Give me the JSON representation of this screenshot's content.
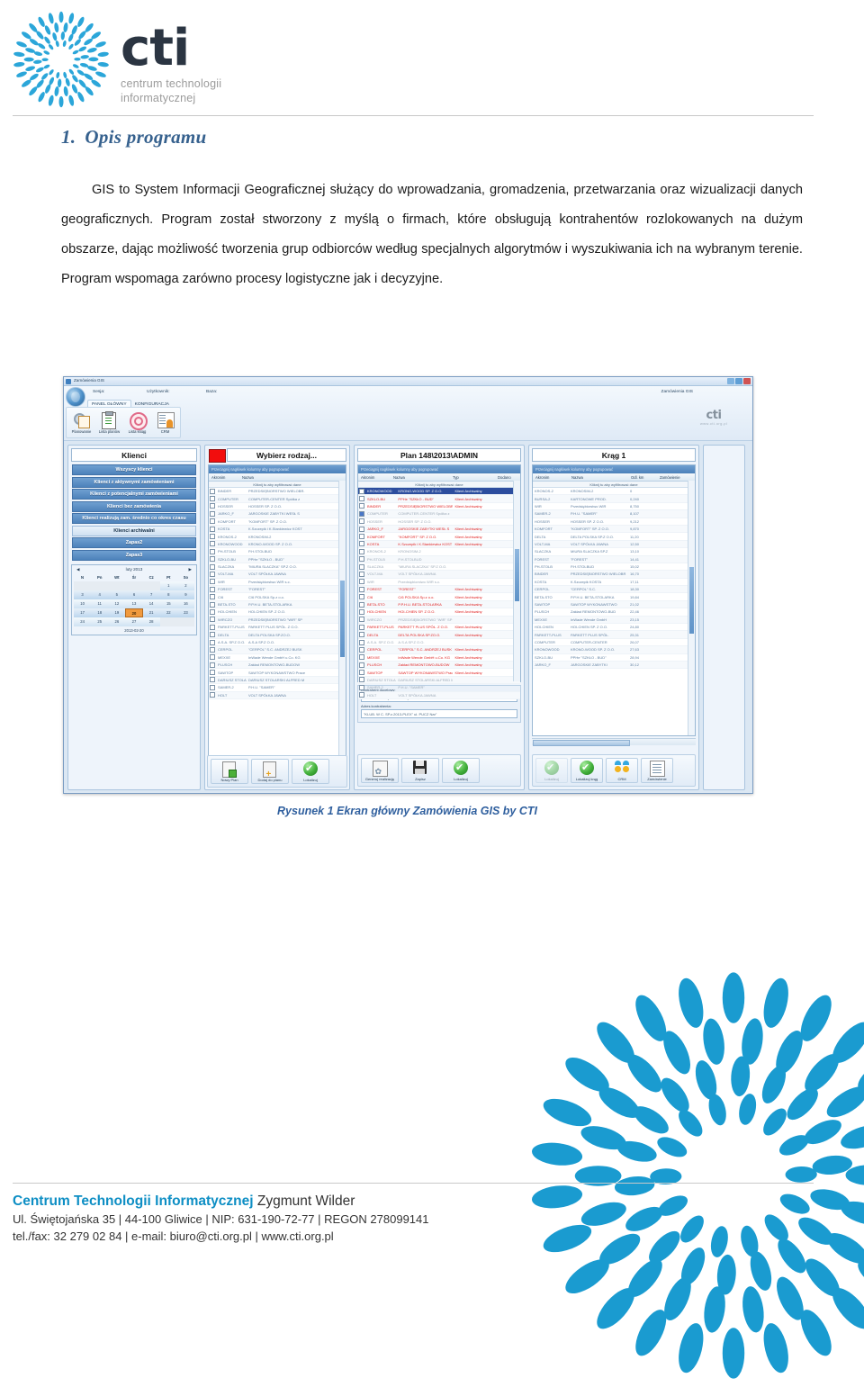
{
  "header": {
    "logo_word": "cti",
    "tagline_line1": "centrum technologii",
    "tagline_line2": "informatycznej"
  },
  "section": {
    "number": "1.",
    "title": "Opis programu",
    "paragraph": "GIS to System Informacji Geograficznej służący do wprowadzania, gromadzenia, przetwarzania oraz wizualizacji danych geograficznych. Program został stworzony z myślą o firmach, które obsługują kontrahentów rozlokowanych  na dużym obszarze, dając możliwość tworzenia grup odbiorców według specjalnych algorytmów  i wyszukiwania  ich  na  wybranym  terenie. Program wspomaga zarówno procesy logistyczne jak i decyzyjne."
  },
  "figure": {
    "caption": "Rysunek 1 Ekran główny Zamówienia GIS by CTI",
    "app": {
      "window_title": "Zamówienia GIS",
      "session_labels": [
        "Sesja:",
        "Użytkownik:",
        "Baza:"
      ],
      "app_name_right": "Zamówienia GIS",
      "tabs": [
        {
          "label": "PANEL GŁÓWNY",
          "active": true
        },
        {
          "label": "KONFIGURACJA",
          "active": false
        }
      ],
      "ribbon_buttons": [
        {
          "label": "Planowanie",
          "icon": "plan-icon"
        },
        {
          "label": "Lista planów",
          "icon": "clipboard-icon"
        },
        {
          "label": "Lista ksiąg",
          "icon": "target-icon"
        },
        {
          "label": "CRM",
          "icon": "person-card-icon"
        }
      ],
      "ribbon_watermark": {
        "word": "cti",
        "url": "www.cti.org.pl"
      },
      "panels": {
        "clients": {
          "title": "Klienci",
          "filters": [
            {
              "label": "Wszyscy klienci",
              "style": "dark"
            },
            {
              "label": "Klienci z aktywnymi zamówieniami",
              "style": "dark"
            },
            {
              "label": "Klienci z potencjalnymi zamówieniami",
              "style": "dark"
            },
            {
              "label": "Klienci bez zamówienia",
              "style": "dark"
            },
            {
              "label": "Klienci realizują zam. średnio co okres czasu",
              "style": "dark"
            },
            {
              "label": "Klienci archiwalni",
              "style": "light"
            },
            {
              "label": "Zapas2",
              "style": "dark"
            },
            {
              "label": "Zapas3",
              "style": "dark"
            }
          ],
          "calendar": {
            "month": "luty 2013",
            "prev": "◀",
            "next": "▶",
            "dow": [
              "N",
              "Pn",
              "Wt",
              "Śr",
              "Cz",
              "Pt",
              "So"
            ],
            "weeks": [
              [
                "",
                "",
                "",
                "",
                "",
                "1",
                "2"
              ],
              [
                "3",
                "4",
                "5",
                "6",
                "7",
                "8",
                "9"
              ],
              [
                "10",
                "11",
                "12",
                "13",
                "14",
                "15",
                "16"
              ],
              [
                "17",
                "18",
                "19",
                "20",
                "21",
                "22",
                "23"
              ],
              [
                "24",
                "25",
                "26",
                "27",
                "28",
                "",
                ""
              ]
            ],
            "selected_day": "20",
            "footer_date": "2013-02-20"
          }
        },
        "kind": {
          "title": "Wybierz rodzaj...",
          "swatch_color": "#f20d0d",
          "group_hint": "Przeciągnij nagłówek kolumny aby pogrupować",
          "filter_hint": "Kliknij tu aby wyfiltrować dane",
          "columns": [
            "Akronim",
            "Nazwa"
          ],
          "rows": [
            [
              "BINDER",
              "PRZEDSIĘBIORSTWO WIELOBR."
            ],
            [
              "COMPUTER",
              "COMPUTER-CENTER Spółka z"
            ],
            [
              "HOSSER",
              "HOSSER SP. Z O.O."
            ],
            [
              "JARKO_F",
              "JARGOSKIE ZABYTKI WESŁ S"
            ],
            [
              "KOMFORT",
              "\"KOMFORT\" SP. Z O.O."
            ],
            [
              "KOSTA",
              "K.Szczepik i K.Stankiewicz KOST"
            ],
            [
              "KRONOS-2",
              "KRONOSIM-2"
            ],
            [
              "KRONOWOOD",
              "KRONO-WOOD SP. Z O.O."
            ],
            [
              "PH-STOLB",
              "P.H.STOLBUD"
            ],
            [
              "SZKLO-BU",
              "PPHe \"SZKŁO - BUD\""
            ],
            [
              "SLACZKA",
              "\"MIURA SLACZKA\" SP.Z O.O."
            ],
            [
              "VOLT-MA",
              "VOLT SPÓŁKA JAWNA"
            ],
            [
              "WIR",
              "Przedsiębiorstwo WIR s.c."
            ],
            [
              "FOREST",
              "\"FOREST\""
            ],
            [
              "C/6",
              "C/6 POLSKA Sp.z o.o."
            ],
            [
              "BETA-STO",
              "P.P.H.U. BETA-STOLARKA"
            ],
            [
              "HOI-CHIEN",
              "HOI-CHIEN SP. Z O.O."
            ],
            [
              "WIRCZO",
              "PRZEDSIĘBIORSTWO \"WIR\" SP"
            ],
            [
              "PARKETT-PLUS",
              "PARKETT PLUS SPÓŁ. Z O.O."
            ],
            [
              "DELTA",
              "DELTA POLSKA SP.ZO.O."
            ],
            [
              "A.S.A. SP.Z O.O.",
              "A.S.A SP.Z O.O."
            ],
            [
              "CERPOL",
              "\"CERPOL\" S.C. ANDRZEJ BUSK"
            ],
            [
              "MEXXE",
              "InWade Wende GmbH u.Co. KG"
            ],
            [
              "PLUSCH",
              "Zakład REMONTOWO-BUDOW"
            ],
            [
              "SAWTOP",
              "SAWTOP WYKONAWSTWO Prace"
            ],
            [
              "DARIUSZ STOLARSKI",
              "DARIUSZ STOLARSKI ALFRED M"
            ],
            [
              "SAMER-2",
              "P.H.U. \"SAMER\""
            ],
            [
              "HOLT",
              "VOLT SPÓŁKA JAWNA"
            ]
          ]
        },
        "plan": {
          "title": "Plan 148\\2013\\ADMIN",
          "group_hint": "Przeciągnij nagłówek kolumny aby pogrupować",
          "filter_hint": "Kliknij tu aby wyfiltrować dane",
          "columns": [
            "Akronim",
            "Nazwa",
            "Typ",
            "Dodano"
          ],
          "rows": [
            {
              "cells": [
                "KRONOWOOD",
                "KRONO-WOOD SP. Z O.O.",
                "Klient Archiwalny",
                ""
              ],
              "state": "selected",
              "checked": false
            },
            {
              "cells": [
                "SZKLO-BU",
                "PPHe \"SZKŁO - BUD\"",
                "Klient Archiwalny",
                ""
              ],
              "state": "red",
              "checked": false
            },
            {
              "cells": [
                "BINDER",
                "PRZEDSIĘBIORSTWO WIELOBR.",
                "Klient Archiwalny",
                ""
              ],
              "state": "red",
              "checked": false
            },
            {
              "cells": [
                "COMPUTER",
                "COMPUTER-CENTER Spółka z",
                "",
                ""
              ],
              "state": "gray",
              "checked": true
            },
            {
              "cells": [
                "HOSSER",
                "HOSSER SP. Z O.O.",
                "",
                ""
              ],
              "state": "gray",
              "checked": false
            },
            {
              "cells": [
                "JARKO_F",
                "JARGOSKIE ZABYTKI WESŁ S",
                "Klient Archiwalny",
                ""
              ],
              "state": "red",
              "checked": false
            },
            {
              "cells": [
                "KOMFORT",
                "\"KOMFORT\" SP. Z O.O.",
                "Klient Archiwalny",
                ""
              ],
              "state": "red",
              "checked": false
            },
            {
              "cells": [
                "KOSTA",
                "K.Szczepik i K.Stankiewicz KOST",
                "Klient Archiwalny",
                ""
              ],
              "state": "red",
              "checked": false
            },
            {
              "cells": [
                "KRONOS-2",
                "KRONOSIM-2",
                "",
                ""
              ],
              "state": "gray",
              "checked": false
            },
            {
              "cells": [
                "PH-STOLB",
                "P.H.STOLBUD",
                "",
                ""
              ],
              "state": "gray",
              "checked": false
            },
            {
              "cells": [
                "SLACZKA",
                "\"MIURA SLACZKA\" SP.Z O.O.",
                "",
                ""
              ],
              "state": "gray",
              "checked": false
            },
            {
              "cells": [
                "VOLT-MA",
                "VOLT SPÓŁKA JAWNA",
                "",
                ""
              ],
              "state": "gray",
              "checked": false
            },
            {
              "cells": [
                "WIR",
                "Przedsiębiorstwo WIR s.c.",
                "",
                ""
              ],
              "state": "gray",
              "checked": false
            },
            {
              "cells": [
                "FOREST",
                "\"FOREST\"",
                "Klient Archiwalny",
                ""
              ],
              "state": "red",
              "checked": false
            },
            {
              "cells": [
                "C/6",
                "C/6 POLSKA Sp.z o.o.",
                "Klient Archiwalny",
                ""
              ],
              "state": "red",
              "checked": false
            },
            {
              "cells": [
                "BETA-STO",
                "P.P.H.U. BETA-STOLARKA",
                "Klient Archiwalny",
                ""
              ],
              "state": "red",
              "checked": false
            },
            {
              "cells": [
                "HOI-CHIEN",
                "HOI-CHIEN SP. Z O.O.",
                "Klient Archiwalny",
                ""
              ],
              "state": "red",
              "checked": false
            },
            {
              "cells": [
                "WIRCZO",
                "PRZEDSIĘBIORSTWO \"WIR\" SP",
                "",
                ""
              ],
              "state": "gray",
              "checked": false
            },
            {
              "cells": [
                "PARKETT-PLUS",
                "PARKETT PLUS SPÓŁ. Z O.O.",
                "Klient Archiwalny",
                ""
              ],
              "state": "red",
              "checked": false
            },
            {
              "cells": [
                "DELTA",
                "DELTA POLSKA SP.ZO.O.",
                "Klient Archiwalny",
                ""
              ],
              "state": "red",
              "checked": false
            },
            {
              "cells": [
                "A.S.A. SP.Z O.O.",
                "A.S.A SP.Z O.O.",
                "",
                ""
              ],
              "state": "gray",
              "checked": false
            },
            {
              "cells": [
                "CERPOL",
                "\"CERPOL\" S.C. ANDRZEJ BUSK",
                "Klient Archiwalny",
                ""
              ],
              "state": "red",
              "checked": false
            },
            {
              "cells": [
                "MEXXE",
                "InWade Wende GmbH u.Co. KG",
                "Klient Archiwalny",
                ""
              ],
              "state": "red",
              "checked": false
            },
            {
              "cells": [
                "PLUSCH",
                "Zakład REMONTOWO-BUDOW",
                "Klient Archiwalny",
                ""
              ],
              "state": "red",
              "checked": false
            },
            {
              "cells": [
                "SAWTOP",
                "SAWTOP WYKONAWSTWO Prace",
                "Klient Archiwalny",
                ""
              ],
              "state": "red",
              "checked": false
            },
            {
              "cells": [
                "DARIUSZ STOLARSKI",
                "DARIUSZ STOLARSKI ALFRED M",
                "",
                ""
              ],
              "state": "gray",
              "checked": false
            },
            {
              "cells": [
                "SAMER-2",
                "P.H.U. \"SAMER\"",
                "",
                ""
              ],
              "state": "gray",
              "checked": false
            },
            {
              "cells": [
                "HOLT",
                "VOLT SPÓŁKA JAWNA",
                "",
                ""
              ],
              "state": "gray",
              "checked": false
            }
          ],
          "fields": [
            {
              "label": "Kontrahent docelowy:",
              "value": "KRONOSIM-2 (KRONOS-2)"
            },
            {
              "label": "Adres kontrahenta:",
              "value": "\"KLUB. W C. SP.z.2013-PLEX\" ul. PUCZ Nar\""
            }
          ],
          "buttons_left": [
            {
              "label": "Nowy Plan",
              "icon": "new-plan-icon"
            },
            {
              "label": "Dodaj do planu",
              "icon": "add-to-plan-icon"
            },
            {
              "label": "Lokalizuj",
              "icon": "locate-icon"
            }
          ],
          "buttons_right": [
            {
              "label": "Generuj realizację",
              "icon": "generate-icon"
            },
            {
              "label": "Zapisz",
              "icon": "save-icon"
            },
            {
              "label": "Lokalizuj",
              "icon": "locate-icon"
            }
          ]
        },
        "circle": {
          "title": "Krąg 1",
          "group_hint": "Przeciągnij nagłówek kolumny aby pogrupować",
          "filter_hint": "Kliknij tu aby wyfiltrować dane",
          "columns": [
            "Akronim",
            "Nazwa",
            "Odl. km",
            "Zamówienie"
          ],
          "rows": [
            [
              "KRONOS-2",
              "KRONOSIM-2",
              "0",
              ""
            ],
            [
              "BURSA-2",
              "KARTONOWE PROD.",
              "0,240",
              ""
            ],
            [
              "WIR",
              "Przedsiębiorstwo WIR",
              "8,750",
              ""
            ],
            [
              "SAMER-2",
              "P.H.U. \"SAMER\"",
              "8,107",
              ""
            ],
            [
              "HOSSER",
              "HOSSER SP. Z O.O.",
              "9,212",
              ""
            ],
            [
              "KOMFORT",
              "\"KOMFORT\" SP. Z O.O.",
              "9,870",
              ""
            ],
            [
              "DELTA",
              "DELTA POLSKA SP.Z O.O.",
              "11,20",
              ""
            ],
            [
              "VOLT-MA",
              "VOLT SPÓŁKA JAWNA",
              "12,50",
              ""
            ],
            [
              "SLACZKA",
              "MIURA SLACZKA SP.Z",
              "13,10",
              ""
            ],
            [
              "FOREST",
              "\"FOREST\"",
              "14,41",
              ""
            ],
            [
              "PH-STOLB",
              "P.H.STOLBUD",
              "15,02",
              ""
            ],
            [
              "BINDER",
              "PRZEDSIĘBIORSTWO WIELOBR",
              "16,70",
              ""
            ],
            [
              "KOSTA",
              "K.Szczepik KOSTA",
              "17,11",
              ""
            ],
            [
              "CERPOL",
              "\"CERPOL\" S.C.",
              "18,30",
              ""
            ],
            [
              "BETA-STO",
              "P.P.H.U. BETA-STOLARKA",
              "19,84",
              ""
            ],
            [
              "SAWTOP",
              "SAWTOP WYKONAWSTWO",
              "21,02",
              ""
            ],
            [
              "PLUSCH",
              "Zakład REMONTOWO-BUD",
              "22,46",
              ""
            ],
            [
              "MEXXE",
              "InWade Wende GmbH",
              "23,15",
              ""
            ],
            [
              "HOI-CHIEN",
              "HOI-CHIEN SP. Z O.O.",
              "24,80",
              ""
            ],
            [
              "PARKETT-PLUS",
              "PARKETT PLUS SPÓŁ.",
              "25,31",
              ""
            ],
            [
              "COMPUTER",
              "COMPUTER-CENTER",
              "26,07",
              ""
            ],
            [
              "KRONOWOOD",
              "KRONO-WOOD SP. Z O.O.",
              "27,63",
              ""
            ],
            [
              "SZKLO-BU",
              "PPHe \"SZKŁO - BUD\"",
              "28,94",
              ""
            ],
            [
              "JARKO_F",
              "JARGOSKIE ZABYTKI",
              "30,12",
              ""
            ]
          ]
        },
        "side": {
          "buttons": [
            {
              "label": "Lokalizuj",
              "icon": "locate-icon",
              "disabled": true
            },
            {
              "label": "Lokalizuj krąg",
              "icon": "locate-circle-icon",
              "disabled": false
            },
            {
              "label": "CRM",
              "icon": "crm-icon",
              "disabled": false
            },
            {
              "label": "Zamówienie",
              "icon": "order-icon",
              "disabled": false
            }
          ]
        }
      }
    }
  },
  "footer": {
    "company_bold": "Centrum Technologii Informatycznej",
    "company_rest": " Zygmunt Wilder",
    "address_line": "Ul. Świętojańska 35  |  44-100 Gliwice  |  NIP: 631-190-72-77  |  REGON 278099141",
    "contact_line": "tel./fax: 32 279 02 84  |  e-mail: biuro@cti.org.pl  |  www.cti.org.pl"
  }
}
